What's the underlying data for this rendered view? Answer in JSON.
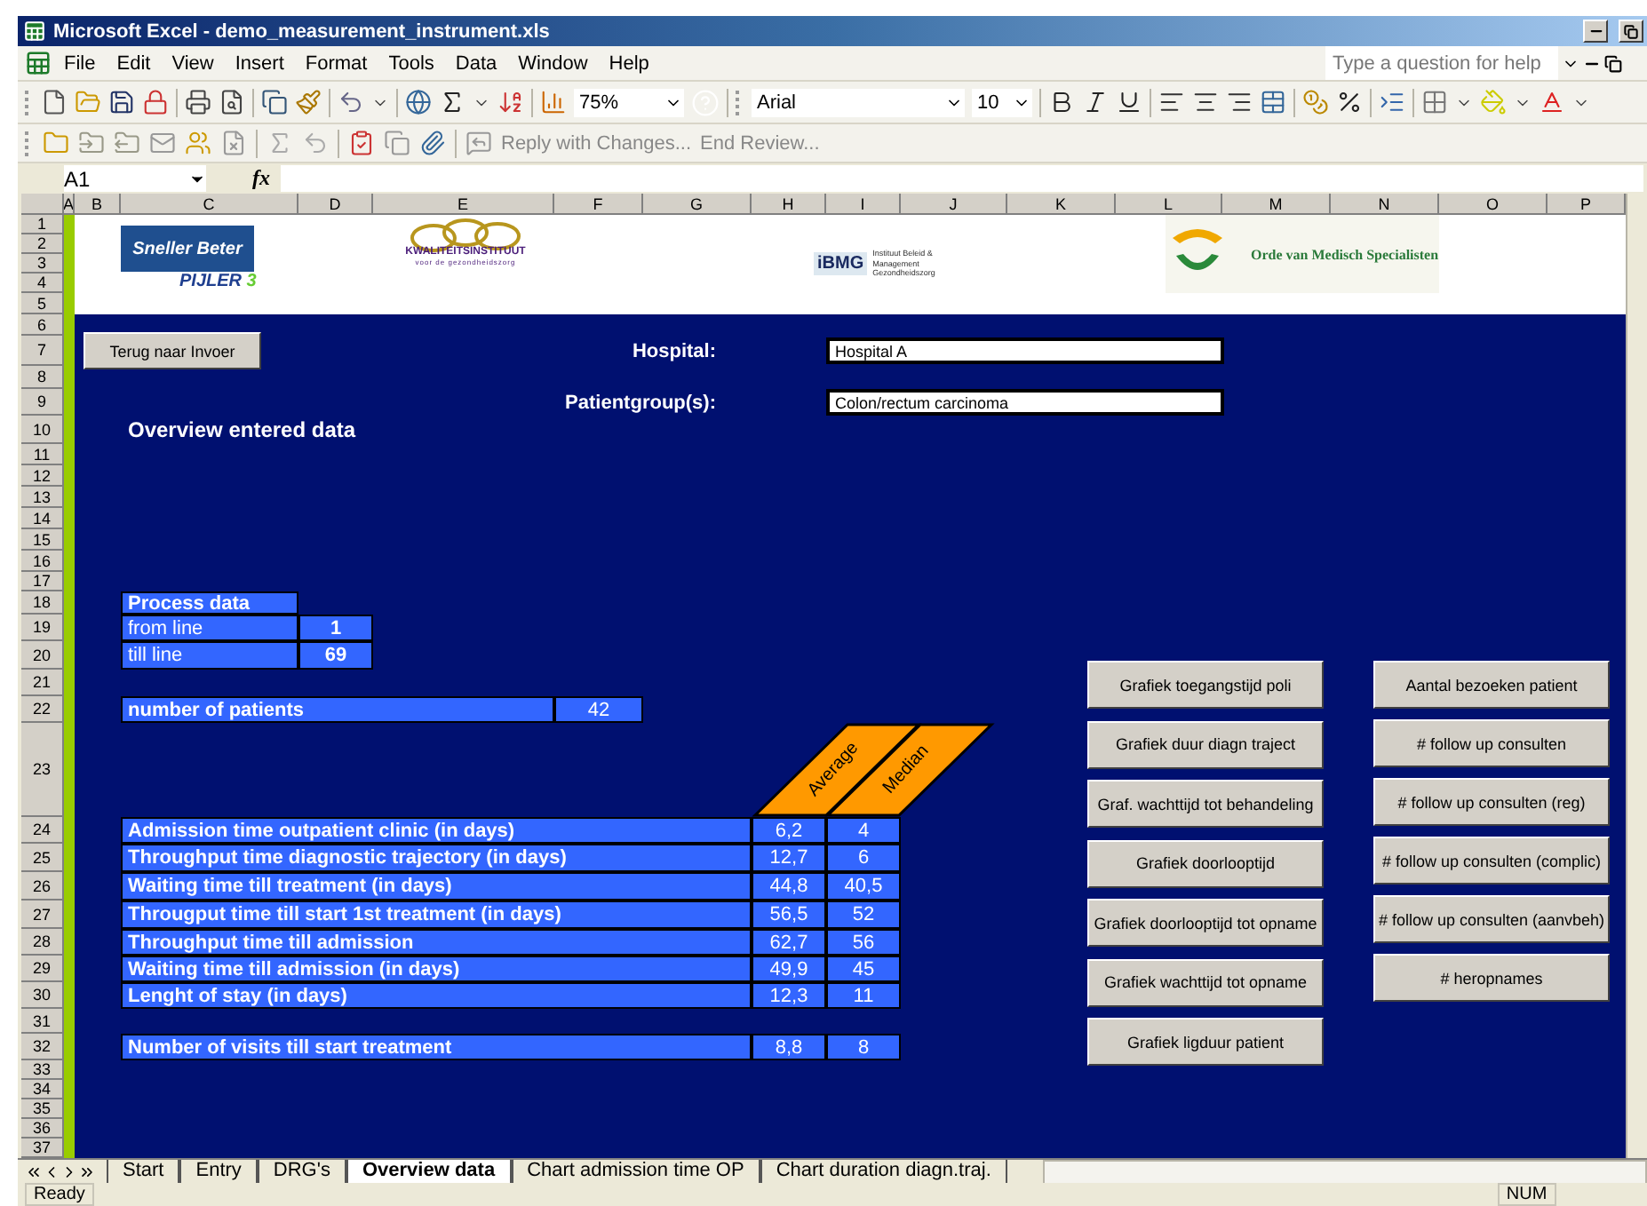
{
  "window": {
    "title": "Microsoft Excel - demo_measurement_instrument.xls"
  },
  "menu": [
    "File",
    "Edit",
    "View",
    "Insert",
    "Format",
    "Tools",
    "Data",
    "Window",
    "Help"
  ],
  "help_search": {
    "placeholder": "Type a question for help"
  },
  "toolbar": {
    "zoom": "75%",
    "font": "Arial",
    "font_size": "10"
  },
  "review_toolbar": {
    "reply": "Reply with Changes...",
    "end_review": "End Review..."
  },
  "formula_bar": {
    "name_box": "A1",
    "function_label": "fx"
  },
  "columns": [
    "A",
    "B",
    "C",
    "D",
    "E",
    "F",
    "G",
    "H",
    "I",
    "J",
    "K",
    "L",
    "M",
    "N",
    "O",
    "P"
  ],
  "rows": [
    "1",
    "2",
    "3",
    "4",
    "5",
    "6",
    "7",
    "8",
    "9",
    "10",
    "11",
    "12",
    "13",
    "14",
    "15",
    "16",
    "17",
    "18",
    "19",
    "20",
    "21",
    "22",
    "23",
    "24",
    "25",
    "26",
    "27",
    "28",
    "29",
    "30",
    "31",
    "32",
    "33",
    "34",
    "35",
    "36",
    "37"
  ],
  "logos": {
    "sneller_beter": {
      "name": "Sneller Beter",
      "subtitle": "PIJLER",
      "number": "3"
    },
    "kwaliteitsinstituut": {
      "name": "KWALITEITSINSTITUUT",
      "tagline": "voor de gezondheidszorg"
    },
    "ibmg": {
      "name": "iBMG",
      "tagline": "Instituut Beleid & Management Gezondheidszorg"
    },
    "orde": {
      "name": "Orde van Medisch Specialisten"
    }
  },
  "sheet": {
    "back_button": "Terug naar Invoer",
    "hospital": {
      "label": "Hospital:",
      "value": "Hospital A"
    },
    "patient_group": {
      "label": "Patientgroup(s):",
      "value": "Colon/rectum carcinoma"
    },
    "heading": "Overview entered data",
    "process_data": {
      "title": "Process data",
      "rows": [
        {
          "label": "from line",
          "value": "1"
        },
        {
          "label": "till line",
          "value": "69"
        }
      ]
    },
    "patients": {
      "label": "number of patients",
      "value": "42"
    },
    "stat_headers": [
      "Average",
      "Median"
    ],
    "stats": [
      {
        "label": "Admission time outpatient clinic (in days)",
        "average": "6,2",
        "median": "4"
      },
      {
        "label": "Throughput time diagnostic trajectory (in days)",
        "average": "12,7",
        "median": "6"
      },
      {
        "label": "Waiting time till treatment (in days)",
        "average": "44,8",
        "median": "40,5"
      },
      {
        "label": "Througput time till start 1st treatment (in days)",
        "average": "56,5",
        "median": "52"
      },
      {
        "label": "Throughput time till admission",
        "average": "62,7",
        "median": "56"
      },
      {
        "label": "Waiting time till admission (in days)",
        "average": "49,9",
        "median": "45"
      },
      {
        "label": "Lenght of stay (in days)",
        "average": "12,3",
        "median": "11"
      }
    ],
    "visits": {
      "label": "Number of visits till start treatment",
      "average": "8,8",
      "median": "8"
    },
    "chart_buttons": [
      "Grafiek toegangstijd poli",
      "Grafiek duur diagn traject",
      "Graf. wachttijd tot behandeling",
      "Grafiek doorlooptijd",
      "Grafiek doorlooptijd tot opname",
      "Grafiek wachttijd tot opname",
      "Grafiek ligduur patient"
    ],
    "count_buttons": [
      "Aantal bezoeken patient",
      "# follow up consulten",
      "# follow up consulten (reg)",
      "# follow up consulten (complic)",
      "# follow up consulten (aanvbeh)",
      "# heropnames"
    ]
  },
  "sheet_tabs": [
    {
      "label": "Start",
      "selected": false
    },
    {
      "label": "Entry",
      "selected": false
    },
    {
      "label": "DRG's",
      "selected": false
    },
    {
      "label": "Overview data",
      "selected": true
    },
    {
      "label": "Chart admission time OP",
      "selected": false
    },
    {
      "label": "Chart duration diagn.traj.",
      "selected": false
    }
  ],
  "status_bar": {
    "status": "Ready",
    "num": "NUM"
  }
}
